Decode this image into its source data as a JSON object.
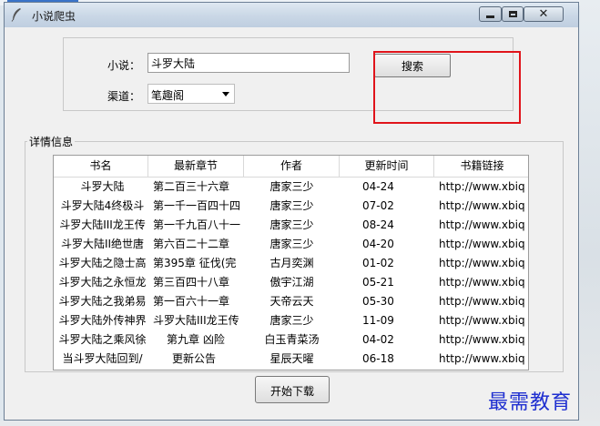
{
  "window": {
    "title": "小说爬虫",
    "controls": {
      "minimize": "minimize",
      "maximize": "maximize",
      "close": "close"
    }
  },
  "form": {
    "novel_label": "小说：",
    "novel_value": "斗罗大陆",
    "channel_label": "渠道：",
    "channel_value": "笔趣阁",
    "search_button": "搜索"
  },
  "details": {
    "legend": "详情信息",
    "columns": [
      "书名",
      "最新章节",
      "作者",
      "更新时间",
      "书籍链接"
    ],
    "rows": [
      [
        "斗罗大陆",
        "第二百三十六章 ",
        "唐家三少",
        "04-24",
        "http://www.xbiq"
      ],
      [
        "斗罗大陆4终极斗",
        "第一千一百四十四",
        "唐家三少",
        "07-02",
        "http://www.xbiq"
      ],
      [
        "斗罗大陆III龙王传",
        "第一千九百八十一",
        "唐家三少",
        "08-24",
        "http://www.xbiq"
      ],
      [
        "斗罗大陆II绝世唐",
        "第六百二十二章 ",
        "唐家三少",
        "04-20",
        "http://www.xbiq"
      ],
      [
        "斗罗大陆之隐士高",
        "第395章 征伐(完",
        "古月奕渊",
        "01-02",
        "http://www.xbiq"
      ],
      [
        "斗罗大陆之永恒龙",
        "第三百四十八章 ",
        "傲宇江湖",
        "05-21",
        "http://www.xbiq"
      ],
      [
        "斗罗大陆之我弟易",
        "第一百六十一章 ",
        "天帝云天",
        "05-30",
        "http://www.xbiq"
      ],
      [
        "斗罗大陆外传神界",
        "斗罗大陆III龙王传",
        "唐家三少",
        "11-09",
        "http://www.xbiq"
      ],
      [
        "斗罗大陆之乘风徐",
        "第九章 凶险",
        "白玉青菜汤",
        "04-02",
        "http://www.xbiq"
      ],
      [
        "当斗罗大陆回到/",
        "更新公告",
        "星辰天曜",
        "06-18",
        "http://www.xbiq"
      ]
    ]
  },
  "actions": {
    "download_button": "开始下载"
  },
  "watermark": "最需教育",
  "colors": {
    "highlight_box": "#e0141b",
    "watermark": "#1f2fd0"
  }
}
